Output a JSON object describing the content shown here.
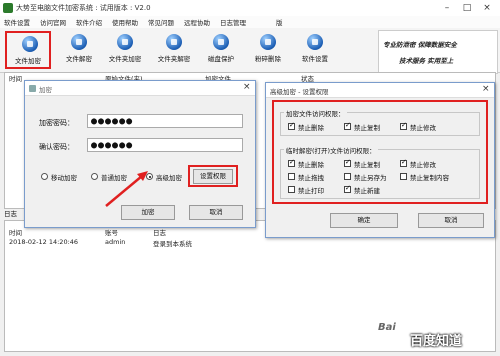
{
  "window": {
    "title": "大势至电脑文件加密系统 : 试用版本 : V2.0"
  },
  "menubar": {
    "items": [
      "软件设置",
      "访问官网",
      "软件介绍",
      "使用帮助",
      "常见问题",
      "远程协助",
      "日志管理",
      "版"
    ]
  },
  "toolbar": {
    "buttons": [
      {
        "label": "文件加密",
        "icon": "lock-icon"
      },
      {
        "label": "文件解密",
        "icon": "unlock-icon"
      },
      {
        "label": "文件夹加密",
        "icon": "folder-lock-icon"
      },
      {
        "label": "文件夹解密",
        "icon": "folder-unlock-icon"
      },
      {
        "label": "磁盘保护",
        "icon": "disk-shield-icon"
      },
      {
        "label": "粉碎删除",
        "icon": "shred-icon"
      },
      {
        "label": "软件设置",
        "icon": "gear-icon"
      }
    ]
  },
  "slogan": {
    "line1": "专业防泄密 保障数据安全",
    "line2": "技术服务 实用至上"
  },
  "file_table": {
    "columns": [
      "时间",
      "原始文件(夹)",
      "加密文件",
      "状态"
    ]
  },
  "log_section": {
    "tab": "日志",
    "columns": [
      "时间",
      "账号",
      "日志"
    ],
    "rows": [
      {
        "time": "2018-02-12 14:20:46",
        "account": "admin",
        "log": "登录到本系统"
      }
    ]
  },
  "encrypt_dialog": {
    "title": "加密",
    "password_label": "加密密码：",
    "password_value": "●●●●●●",
    "confirm_label": "确认密码：",
    "confirm_value": "●●●●●●",
    "modes": [
      "移动加密",
      "普通加密",
      "高级加密"
    ],
    "selected_mode": "高级加密",
    "set_permission_button": "设置权限",
    "ok_button": "加密",
    "cancel_button": "取消"
  },
  "permission_dialog": {
    "title": "高级加密 - 设置权限",
    "group1": {
      "title": "加密文件访问权限：",
      "items": [
        {
          "label": "禁止删除",
          "checked": true
        },
        {
          "label": "禁止复制",
          "checked": true
        },
        {
          "label": "禁止修改",
          "checked": true
        }
      ]
    },
    "group2": {
      "title": "临时解密(打开)文件访问权限：",
      "items": [
        {
          "label": "禁止删除",
          "checked": true
        },
        {
          "label": "禁止复制",
          "checked": true
        },
        {
          "label": "禁止修改",
          "checked": true
        },
        {
          "label": "禁止拖拽",
          "checked": false
        },
        {
          "label": "禁止另存为",
          "checked": false
        },
        {
          "label": "禁止复制内容",
          "checked": false
        },
        {
          "label": "禁止打印",
          "checked": false
        },
        {
          "label": "禁止新建",
          "checked": true
        }
      ]
    },
    "ok_button": "确定",
    "cancel_button": "取消"
  },
  "watermark": {
    "text": "百度知道",
    "brand": "Bai"
  }
}
